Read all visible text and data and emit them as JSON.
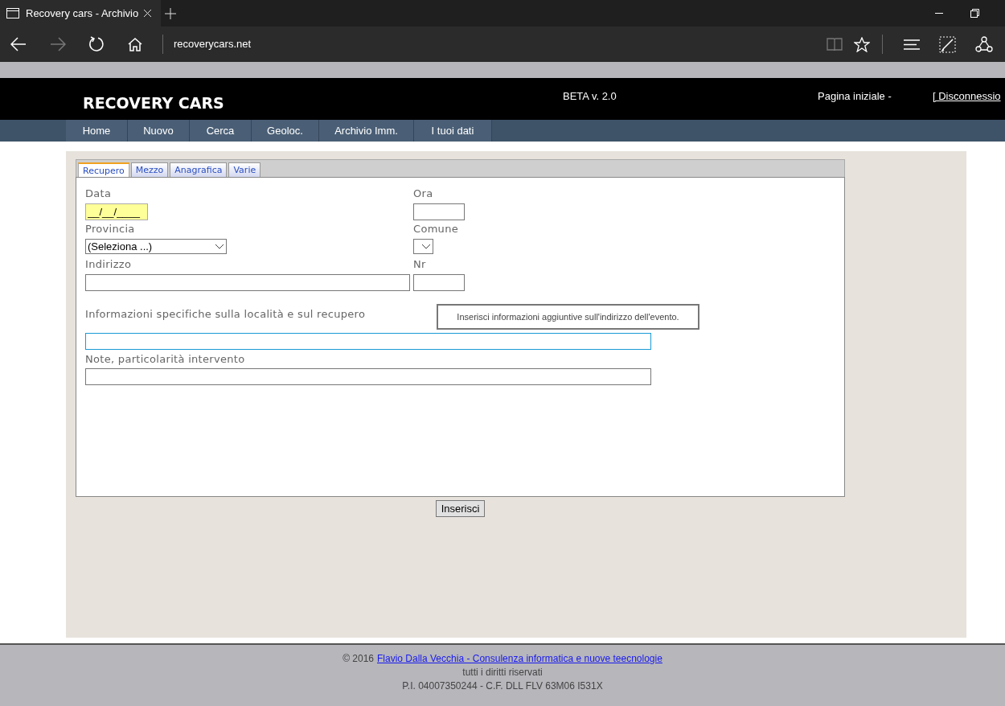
{
  "browser": {
    "tab_title": "Recovery cars - Archivio",
    "url": "recoverycars.net"
  },
  "header": {
    "logo": "RECOVERY CARS",
    "version": "BETA v. 2.0",
    "home_link": "Pagina iniziale -",
    "logout": "[ Disconnessio"
  },
  "nav": [
    "Home",
    "Nuovo",
    "Cerca",
    "Geoloc.",
    "Archivio Imm.",
    "I tuoi dati"
  ],
  "form_tabs": [
    {
      "label": "Recupero",
      "selected": true
    },
    {
      "label": "Mezzo",
      "selected": false
    },
    {
      "label": "Anagrafica",
      "selected": false
    },
    {
      "label": "Varie",
      "selected": false
    }
  ],
  "field_rows": [
    [
      {
        "label": "Data",
        "kind": "masked",
        "value": "__/__/____"
      },
      {
        "label": "Ora",
        "kind": "text"
      }
    ],
    [
      {
        "label": "Provincia",
        "kind": "select",
        "value": "(Seleziona ...)"
      },
      {
        "label": "Comune",
        "kind": "select"
      }
    ],
    [
      {
        "label": "Indirizzo",
        "kind": "text"
      },
      {
        "label": "Nr",
        "kind": "text"
      }
    ]
  ],
  "wide_fields": [
    {
      "label": "Informazioni specifiche sulla località e sul recupero",
      "focused": true,
      "tooltip": "Inserisci informazioni aggiuntive sull'indirizzo dell'evento."
    },
    {
      "label": "Note, particolarità intervento",
      "focused": false
    }
  ],
  "submit": "Inserisci",
  "footer": {
    "copyright": "© 2016",
    "link": "Flavio Dalla Vecchia - Consulenza informatica e nuove teecnologie",
    "rights": "tutti i diritti riservati",
    "tax": "P.I. 04007350244 - C.F. DLL FLV 63M06 I531X"
  }
}
